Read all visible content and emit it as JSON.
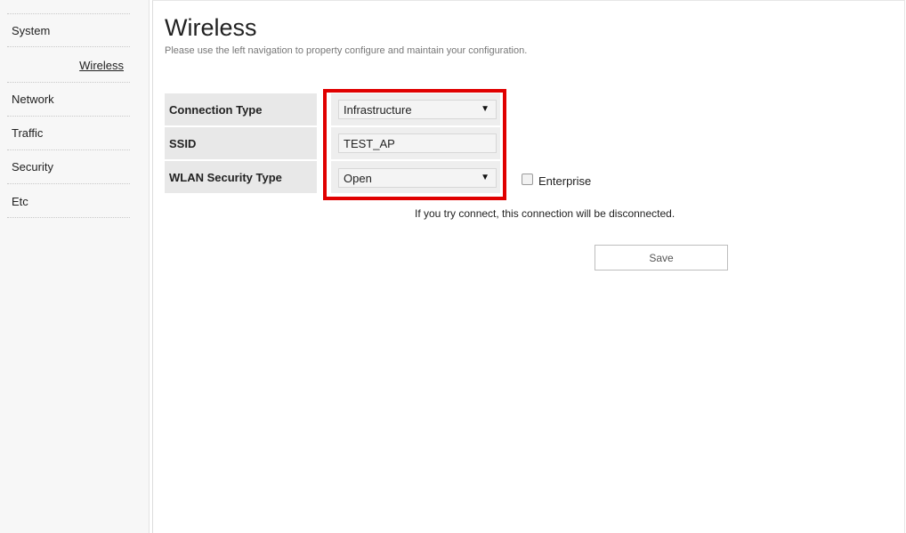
{
  "sidebar": {
    "items": [
      {
        "label": "System"
      },
      {
        "label": "Wireless"
      },
      {
        "label": "Network"
      },
      {
        "label": "Traffic"
      },
      {
        "label": "Security"
      },
      {
        "label": "Etc"
      }
    ]
  },
  "page": {
    "title": "Wireless",
    "description": "Please use the left navigation to property configure and maintain your configuration."
  },
  "form": {
    "connection_type": {
      "label": "Connection Type",
      "value": "Infrastructure"
    },
    "ssid": {
      "label": "SSID",
      "value": "TEST_AP"
    },
    "wlan_security_type": {
      "label": "WLAN Security Type",
      "value": "Open"
    },
    "enterprise": {
      "label": "Enterprise",
      "checked": false
    }
  },
  "notice": "If you try connect, this connection will be disconnected.",
  "actions": {
    "save_label": "Save"
  },
  "colors": {
    "highlight": "#e00000"
  },
  "icons": {
    "dropdown": "triangle-down-icon",
    "checkbox": "checkbox-icon"
  }
}
